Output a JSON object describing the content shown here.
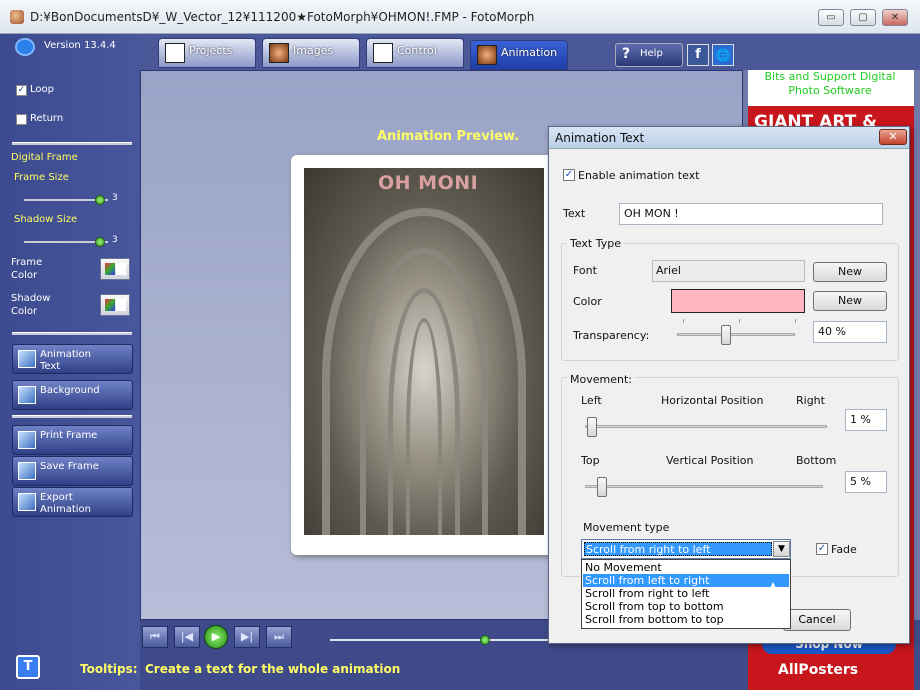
{
  "window": {
    "title": "D:¥BonDocumentsD¥_W_Vector_12¥111200★FotoMorph¥OHMON!.FMP - FotoMorph",
    "minimize": "▭",
    "restore": "▢",
    "close": "✕"
  },
  "sidebar": {
    "version": "Version 13.4.4",
    "loop_label": "Loop",
    "loop_checked": "✓",
    "return_label": "Return",
    "digital_frame": "Digital Frame",
    "frame_size_label": "Frame Size",
    "frame_size_value": "3",
    "shadow_size_label": "Shadow Size",
    "shadow_size_value": "3",
    "frame_color_label": "Frame Color",
    "shadow_color_label": "Shadow Color",
    "buttons": {
      "animation_text": "Animation Text",
      "background": "Background",
      "print_frame": "Print Frame",
      "save_frame": "Save Frame",
      "export_animation": "Export Animation"
    },
    "tooltip_button": "T"
  },
  "tabs": {
    "projects": "Projects",
    "images": "Images",
    "control": "Control",
    "animation": "Animation",
    "help": "Help",
    "facebook": "f",
    "web": "🌐"
  },
  "preview": {
    "title": "Animation Preview.",
    "photo_text": "OH MONI"
  },
  "playback": {
    "first": "⏮",
    "prev": "|◀",
    "play": "▶",
    "next": "▶|",
    "last": "⏭"
  },
  "tooltip": {
    "label": "Tooltips:",
    "text": "Create a text for the whole animation"
  },
  "ad": {
    "top_text": "Bits and Support Digital Photo Software",
    "banner_title": "GIANT ART &",
    "shop_now": "Shop Now",
    "allposters": "AllPosters"
  },
  "dialog": {
    "title": "Animation Text",
    "close": "✕",
    "enable_label": "Enable animation text",
    "enable_checked": "✓",
    "text_label": "Text",
    "text_value": "OH MON !",
    "text_type_label": "Text Type",
    "font_label": "Font",
    "font_value": "Ariel",
    "font_new": "New",
    "color_label": "Color",
    "color_new": "New",
    "transparency_label": "Transparency:",
    "transparency_value": "40 %",
    "movement_label": "Movement:",
    "left_label": "Left",
    "horizontal_label": "Horizontal Position",
    "right_label": "Right",
    "horizontal_value": "1 %",
    "top_label": "Top",
    "vertical_label": "Vertical Position",
    "bottom_label": "Bottom",
    "vertical_value": "5 %",
    "movement_type_label": "Movement type",
    "movement_type_selected": "Scroll from right to left",
    "fade_label": "Fade",
    "fade_checked": "✓",
    "options": [
      "No Movement",
      "Scroll from left to right",
      "Scroll from right to left",
      "Scroll from top to bottom",
      "Scroll from bottom to top"
    ],
    "cancel": "Cancel",
    "colors": {
      "text_color": "#ffb6c1"
    }
  }
}
